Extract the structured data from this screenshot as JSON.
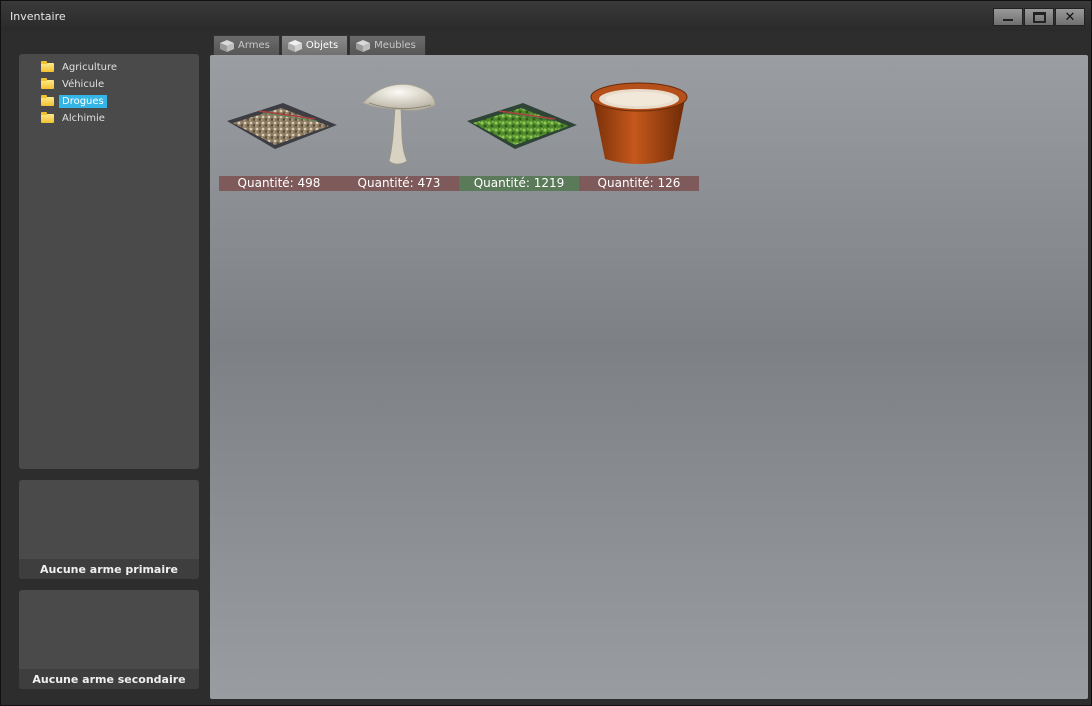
{
  "window": {
    "title": "Inventaire",
    "controls": [
      "minimize-icon",
      "maximize-icon",
      "close-icon"
    ],
    "close_glyph": "✕"
  },
  "tabs": [
    {
      "label": "Armes",
      "active": false,
      "icon": "cube-icon"
    },
    {
      "label": "Objets",
      "active": true,
      "icon": "cube-icon"
    },
    {
      "label": "Meubles",
      "active": false,
      "icon": "cube-icon"
    }
  ],
  "categories": [
    {
      "label": "Agriculture",
      "selected": false,
      "icon": "folder-icon"
    },
    {
      "label": "Véhicule",
      "selected": false,
      "icon": "folder-icon"
    },
    {
      "label": "Drogues",
      "selected": true,
      "icon": "folder-icon"
    },
    {
      "label": "Alchimie",
      "selected": false,
      "icon": "folder-icon"
    }
  ],
  "weapon_slots": {
    "primary": "Aucune arme primaire",
    "secondary": "Aucune arme secondaire"
  },
  "items": [
    {
      "icon": "seed-bag-icon",
      "quantity": "Quantité: 498",
      "badge_color": "#7e5a5b"
    },
    {
      "icon": "mushroom-icon",
      "quantity": "Quantité: 473",
      "badge_color": "#7e5a5b"
    },
    {
      "icon": "leaf-bag-icon",
      "quantity": "Quantité: 1219",
      "badge_color": "#5a7a5a"
    },
    {
      "icon": "flower-pot-icon",
      "quantity": "Quantité: 126",
      "badge_color": "#7e5a5b"
    }
  ],
  "colors": {
    "selection": "#33b5e5",
    "panel": "#4a4a4a",
    "window": "#2d2d2d"
  }
}
